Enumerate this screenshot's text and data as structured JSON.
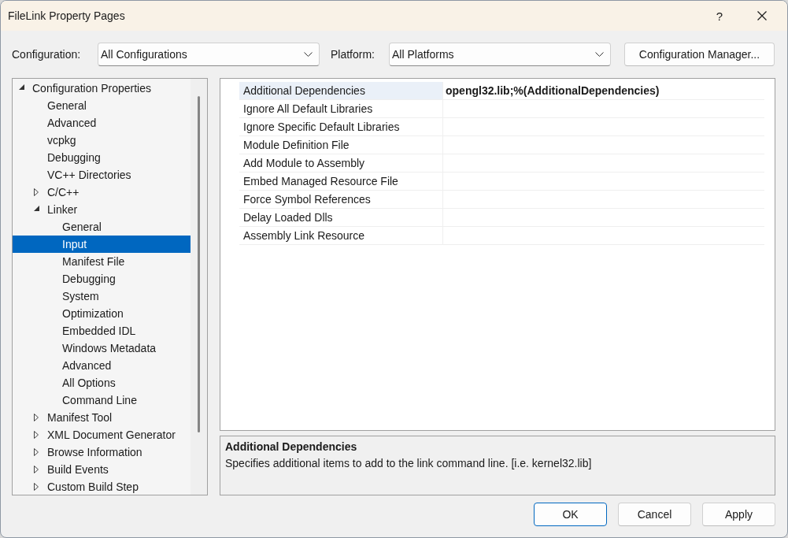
{
  "window": {
    "title": "FileLink Property Pages",
    "help_button": "?"
  },
  "toolbar": {
    "configuration": {
      "label": "Configuration:",
      "value": "All Configurations"
    },
    "platform": {
      "label": "Platform:",
      "value": "All Platforms"
    },
    "configuration_manager_button": "Configuration Manager..."
  },
  "tree": [
    {
      "label": "Configuration Properties",
      "kind": "folder",
      "expanded": true,
      "selected": false,
      "children": [
        {
          "label": "General",
          "kind": "page",
          "selected": false
        },
        {
          "label": "Advanced",
          "kind": "page",
          "selected": false
        },
        {
          "label": "vcpkg",
          "kind": "page",
          "selected": false
        },
        {
          "label": "Debugging",
          "kind": "page",
          "selected": false
        },
        {
          "label": "VC++ Directories",
          "kind": "page",
          "selected": false
        },
        {
          "label": "C/C++",
          "kind": "folder",
          "expanded": false,
          "selected": false
        },
        {
          "label": "Linker",
          "kind": "folder",
          "expanded": true,
          "selected": false,
          "children": [
            {
              "label": "General",
              "kind": "page",
              "selected": false
            },
            {
              "label": "Input",
              "kind": "page",
              "selected": true
            },
            {
              "label": "Manifest File",
              "kind": "page",
              "selected": false
            },
            {
              "label": "Debugging",
              "kind": "page",
              "selected": false
            },
            {
              "label": "System",
              "kind": "page",
              "selected": false
            },
            {
              "label": "Optimization",
              "kind": "page",
              "selected": false
            },
            {
              "label": "Embedded IDL",
              "kind": "page",
              "selected": false
            },
            {
              "label": "Windows Metadata",
              "kind": "page",
              "selected": false
            },
            {
              "label": "Advanced",
              "kind": "page",
              "selected": false
            },
            {
              "label": "All Options",
              "kind": "page",
              "selected": false
            },
            {
              "label": "Command Line",
              "kind": "page",
              "selected": false
            }
          ]
        },
        {
          "label": "Manifest Tool",
          "kind": "folder",
          "expanded": false,
          "selected": false
        },
        {
          "label": "XML Document Generator",
          "kind": "folder",
          "expanded": false,
          "selected": false
        },
        {
          "label": "Browse Information",
          "kind": "folder",
          "expanded": false,
          "selected": false
        },
        {
          "label": "Build Events",
          "kind": "folder",
          "expanded": false,
          "selected": false
        },
        {
          "label": "Custom Build Step",
          "kind": "folder",
          "expanded": false,
          "selected": false
        }
      ]
    }
  ],
  "property_grid": {
    "rows": [
      {
        "name": "Additional Dependencies",
        "value": "opengl32.lib;%(AdditionalDependencies)",
        "selected": true
      },
      {
        "name": "Ignore All Default Libraries",
        "selected": false
      },
      {
        "name": "Ignore Specific Default Libraries",
        "selected": false
      },
      {
        "name": "Module Definition File",
        "selected": false
      },
      {
        "name": "Add Module to Assembly",
        "selected": false
      },
      {
        "name": "Embed Managed Resource File",
        "selected": false
      },
      {
        "name": "Force Symbol References",
        "selected": false
      },
      {
        "name": "Delay Loaded Dlls",
        "selected": false
      },
      {
        "name": "Assembly Link Resource",
        "selected": false
      }
    ]
  },
  "description": {
    "title": "Additional Dependencies",
    "text": "Specifies additional items to add to the link command line. [i.e. kernel32.lib]"
  },
  "buttons": [
    {
      "label": "OK",
      "default": true
    },
    {
      "label": "Cancel",
      "default": false
    },
    {
      "label": "Apply",
      "default": false
    }
  ]
}
